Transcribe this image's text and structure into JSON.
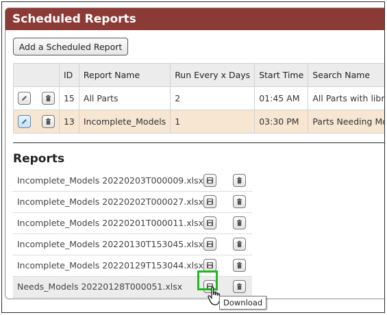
{
  "panel": {
    "title": "Scheduled Reports"
  },
  "toolbar": {
    "add_label": "Add a Scheduled Report"
  },
  "schedule_table": {
    "headers": [
      "ID",
      "Report Name",
      "Run Every x Days",
      "Start Time",
      "Search Name"
    ],
    "rows": [
      {
        "id": "15",
        "report_name": "All Parts",
        "run_every": "2",
        "start_time": "01:45 AM",
        "search_name": "All Parts with library"
      },
      {
        "id": "13",
        "report_name": "Incomplete_Models",
        "run_every": "1",
        "start_time": "03:30 PM",
        "search_name": "Parts Needing Models"
      }
    ]
  },
  "reports": {
    "title": "Reports",
    "files": [
      "Incomplete_Models 20220203T000009.xlsx",
      "Incomplete_Models 20220202T000027.xlsx",
      "Incomplete_Models 20220201T000011.xlsx",
      "Incomplete_Models 20220130T153045.xlsx",
      "Incomplete_Models 20220129T153044.xlsx",
      "Needs_Models 20220128T000051.xlsx"
    ]
  },
  "tooltip": {
    "text": "Download"
  },
  "colors": {
    "title_bar": "#8c3a35",
    "highlight_row": "#f6e6d2",
    "highlight_box": "#22b722"
  }
}
